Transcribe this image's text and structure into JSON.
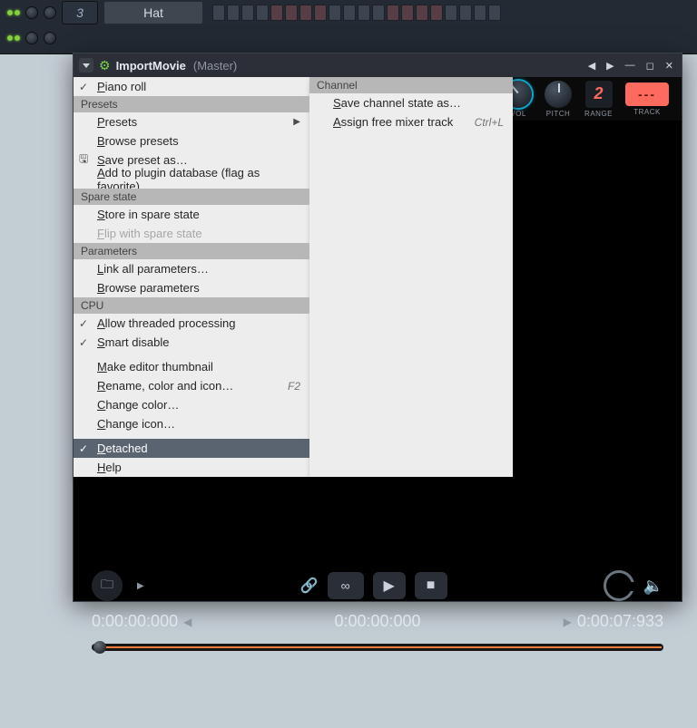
{
  "bg": {
    "channel_number": "3",
    "channel_name": "Hat"
  },
  "window": {
    "title": "ImportMovie",
    "subtitle": "(Master)",
    "knobs": {
      "vol_label": "VOL",
      "pitch_label": "PITCH",
      "range_label": "RANGE",
      "range_value": "2",
      "track_label": "TRACK",
      "track_value": "---"
    }
  },
  "menu_left": {
    "items": [
      {
        "type": "item",
        "label": "Piano roll",
        "mark": "✓"
      },
      {
        "type": "section",
        "label": "Presets"
      },
      {
        "type": "item",
        "label": "Presets",
        "sub": "▶"
      },
      {
        "type": "item",
        "label": "Browse presets"
      },
      {
        "type": "item",
        "label": "Save preset as…",
        "mark": "🖫"
      },
      {
        "type": "item",
        "label": "Add to plugin database (flag as favorite)"
      },
      {
        "type": "section",
        "label": "Spare state"
      },
      {
        "type": "item",
        "label": "Store in spare state"
      },
      {
        "type": "item",
        "label": "Flip with spare state",
        "disabled": true
      },
      {
        "type": "section",
        "label": "Parameters"
      },
      {
        "type": "item",
        "label": "Link all parameters…"
      },
      {
        "type": "item",
        "label": "Browse parameters"
      },
      {
        "type": "section",
        "label": "CPU"
      },
      {
        "type": "item",
        "label": "Allow threaded processing",
        "mark": "✓"
      },
      {
        "type": "item",
        "label": "Smart disable",
        "mark": "✓"
      },
      {
        "type": "gap"
      },
      {
        "type": "item",
        "label": "Make editor thumbnail"
      },
      {
        "type": "item",
        "label": "Rename, color and icon…",
        "shortcut": "F2"
      },
      {
        "type": "item",
        "label": "Change color…"
      },
      {
        "type": "item",
        "label": "Change icon…"
      },
      {
        "type": "gap"
      },
      {
        "type": "item",
        "label": "Detached",
        "mark": "✓",
        "selected": true
      },
      {
        "type": "item",
        "label": "Help"
      }
    ]
  },
  "menu_right": {
    "section": "Channel",
    "items": [
      {
        "label": "Save channel state as…"
      },
      {
        "label": "Assign free mixer track",
        "shortcut": "Ctrl+L"
      }
    ]
  },
  "transport": {
    "tc_left": "0:00:00:000",
    "tc_center": "0:00:00:000",
    "tc_right": "0:00:07:933",
    "loop_glyph": "∞"
  }
}
